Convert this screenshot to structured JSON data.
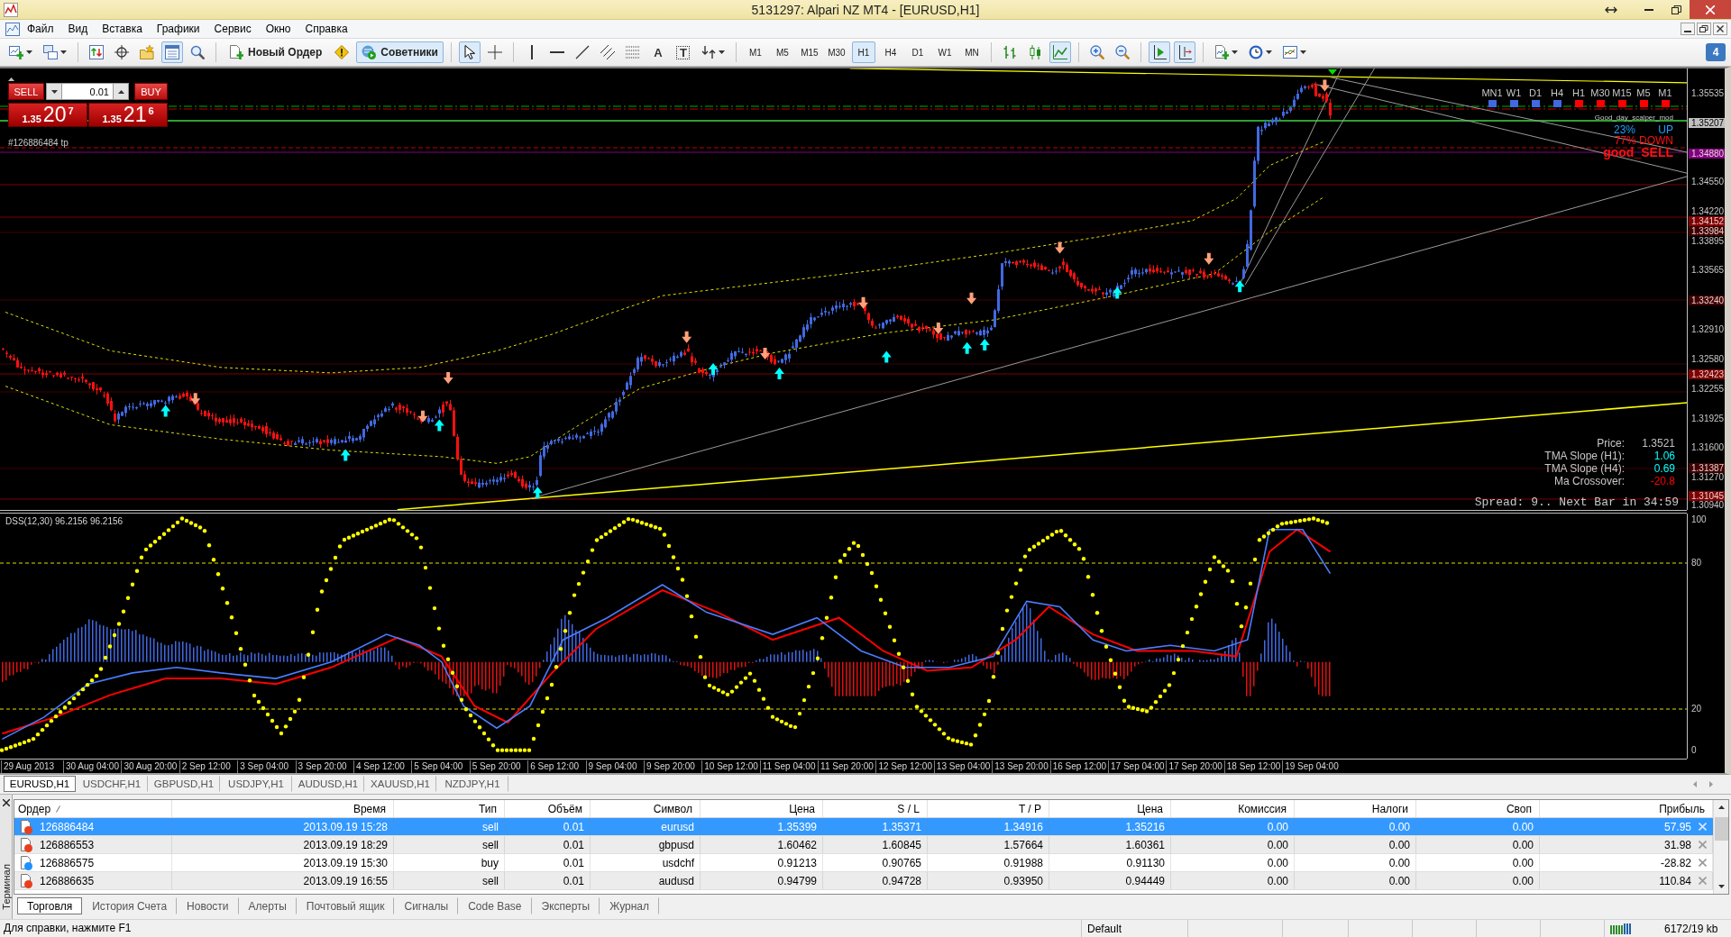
{
  "window": {
    "title": "5131297: Alpari NZ MT4 - [EURUSD,H1]"
  },
  "menu": [
    "Файл",
    "Вид",
    "Вставка",
    "Графики",
    "Сервис",
    "Окно",
    "Справка"
  ],
  "toolbar": {
    "window_tools": [
      {
        "kind": "new-chart",
        "pressed": false
      },
      {
        "kind": "profiles",
        "pressed": false
      },
      {
        "kind": "market-watch",
        "pressed": false
      },
      {
        "kind": "data-window",
        "pressed": false
      },
      {
        "kind": "favorites",
        "pressed": false
      },
      {
        "kind": "terminal",
        "pressed": true
      },
      {
        "kind": "tester",
        "pressed": false
      }
    ],
    "new_order": "Новый Ордер",
    "experts": {
      "label": "Советники",
      "pressed": true
    },
    "line_tools": [
      {
        "kind": "cursor",
        "selected": true
      },
      {
        "kind": "crosshair",
        "selected": false
      },
      {
        "kind": "vertical-line",
        "selected": false
      },
      {
        "kind": "horizontal-line",
        "selected": false
      },
      {
        "kind": "trend-line",
        "selected": false
      },
      {
        "kind": "channel",
        "selected": false
      },
      {
        "kind": "grid",
        "selected": false
      },
      {
        "kind": "text",
        "label": "A",
        "selected": false
      },
      {
        "kind": "text-label",
        "label": "T",
        "selected": false
      },
      {
        "kind": "arrows",
        "selected": false
      }
    ],
    "timeframes": [
      {
        "label": "M1",
        "selected": false
      },
      {
        "label": "M5",
        "selected": false
      },
      {
        "label": "M15",
        "selected": false
      },
      {
        "label": "M30",
        "selected": false
      },
      {
        "label": "H1",
        "selected": true
      },
      {
        "label": "H4",
        "selected": false
      },
      {
        "label": "D1",
        "selected": false
      },
      {
        "label": "W1",
        "selected": false
      },
      {
        "label": "MN",
        "selected": false
      }
    ],
    "chart_types": [
      {
        "kind": "bars",
        "selected": false
      },
      {
        "kind": "candles",
        "selected": false
      },
      {
        "kind": "line",
        "selected": true
      }
    ],
    "view_toggles": [
      {
        "kind": "autoscroll",
        "pressed": true
      },
      {
        "kind": "shift",
        "pressed": true
      }
    ],
    "messages_badge": "4"
  },
  "chart": {
    "trade_panel": {
      "sell_label": "SELL",
      "buy_label": "BUY",
      "lot": "0.01",
      "sell_price": {
        "prefix": "1.35",
        "big": "20",
        "sup": "7"
      },
      "buy_price": {
        "prefix": "1.35",
        "big": "21",
        "sup": "6"
      }
    },
    "order_line_label": "#126886484 tp",
    "timeframe_signals": [
      {
        "label": "MN1",
        "color": "#4169e1"
      },
      {
        "label": "W1",
        "color": "#4169e1"
      },
      {
        "label": "D1",
        "color": "#4169e1"
      },
      {
        "label": "H4",
        "color": "#4169e1"
      },
      {
        "label": "H1",
        "color": "#ff0000"
      },
      {
        "label": "M30",
        "color": "#ff0000"
      },
      {
        "label": "M15",
        "color": "#ff0000"
      },
      {
        "label": "M5",
        "color": "#ff0000"
      },
      {
        "label": "M1",
        "color": "#ff0000"
      }
    ],
    "indicator_name": "Good_day_scalper_mod",
    "trend_odds": {
      "up_share": "23%",
      "up_label": "UP",
      "down": "77% DOWN",
      "signal": "good_SELL"
    },
    "info": [
      {
        "label": "Price:",
        "value": "1.3521",
        "color": "#c0c0c0"
      },
      {
        "label": "TMA Slope (H1):",
        "value": "1.06",
        "color": "#00ffff"
      },
      {
        "label": "TMA Slope (H4):",
        "value": "0.69",
        "color": "#00ffff"
      },
      {
        "label": "Ma Crossover:",
        "value": "-20.8",
        "color": "#ff0000"
      }
    ],
    "spread": "Spread: 9.. Next Bar in 34:59",
    "price_axis": {
      "ticks": [
        "1.35535",
        "1.34550",
        "1.34220",
        "1.33895",
        "1.33565",
        "1.32910",
        "1.32580",
        "1.32255",
        "1.31925",
        "1.31600",
        "1.31270",
        "1.30940"
      ],
      "levels": [
        {
          "label": "1.35207",
          "color": "#c0c0c0"
        },
        {
          "label": "1.34880",
          "color": "#800080"
        },
        {
          "label": "1.34152",
          "color": "#800000"
        },
        {
          "label": "1.33984",
          "color": "#400000"
        },
        {
          "label": "1.33240",
          "color": "#400000"
        },
        {
          "label": "1.32423",
          "color": "#800000"
        },
        {
          "label": "1.31387",
          "color": "#400000"
        },
        {
          "label": "1.31045",
          "color": "#800000"
        }
      ]
    },
    "oscillator": {
      "label": "DSS(12,30) 96.2156 96.2156",
      "ticks": [
        "100",
        "80",
        "20",
        "0"
      ]
    },
    "time_axis": [
      "29 Aug 2013",
      "30 Aug 04:00",
      "30 Aug 20:00",
      "2 Sep 12:00",
      "3 Sep 04:00",
      "3 Sep 20:00",
      "4 Sep 12:00",
      "5 Sep 04:00",
      "5 Sep 20:00",
      "6 Sep 12:00",
      "9 Sep 04:00",
      "9 Sep 20:00",
      "10 Sep 12:00",
      "11 Sep 04:00",
      "11 Sep 20:00",
      "12 Sep 12:00",
      "13 Sep 04:00",
      "13 Sep 20:00",
      "16 Sep 12:00",
      "17 Sep 04:00",
      "17 Sep 20:00",
      "18 Sep 12:00",
      "19 Sep 04:00"
    ]
  },
  "chart_tabs": [
    {
      "label": "EURUSD,H1",
      "selected": true
    },
    {
      "label": "USDCHF,H1",
      "selected": false
    },
    {
      "label": "GBPUSD,H1",
      "selected": false
    },
    {
      "label": "USDJPY,H1",
      "selected": false
    },
    {
      "label": "AUDUSD,H1",
      "selected": false
    },
    {
      "label": "XAUUSD,H1",
      "selected": false
    },
    {
      "label": "NZDJPY,H1",
      "selected": false
    }
  ],
  "terminal": {
    "title": "Терминал",
    "columns": [
      "Ордер",
      "Время",
      "Тип",
      "Объём",
      "Символ",
      "Цена",
      "S / L",
      "T / P",
      "Цена",
      "Комиссия",
      "Налоги",
      "Своп",
      "Прибыль"
    ],
    "rows": [
      {
        "selected": true,
        "color": "#e8401c",
        "cells": [
          "126886484",
          "2013.09.19 15:28",
          "sell",
          "0.01",
          "eurusd",
          "1.35399",
          "1.35371",
          "1.34916",
          "1.35216",
          "0.00",
          "0.00",
          "0.00",
          "57.95"
        ]
      },
      {
        "selected": false,
        "color": "#e8401c",
        "cells": [
          "126886553",
          "2013.09.19 18:29",
          "sell",
          "0.01",
          "gbpusd",
          "1.60462",
          "1.60845",
          "1.57664",
          "1.60361",
          "0.00",
          "0.00",
          "0.00",
          "31.98"
        ]
      },
      {
        "selected": false,
        "color": "#1e90ff",
        "cells": [
          "126886575",
          "2013.09.19 15:30",
          "buy",
          "0.01",
          "usdchf",
          "0.91213",
          "0.90765",
          "0.91988",
          "0.91130",
          "0.00",
          "0.00",
          "0.00",
          "-28.82"
        ]
      },
      {
        "selected": false,
        "color": "#e8401c",
        "cells": [
          "126886635",
          "2013.09.19 16:55",
          "sell",
          "0.01",
          "audusd",
          "0.94799",
          "0.94728",
          "0.93950",
          "0.94449",
          "0.00",
          "0.00",
          "0.00",
          "110.84"
        ]
      }
    ],
    "tabs": [
      {
        "label": "Торговля",
        "selected": true
      },
      {
        "label": "История Счета",
        "selected": false
      },
      {
        "label": "Новости",
        "selected": false
      },
      {
        "label": "Алерты",
        "selected": false
      },
      {
        "label": "Почтовый ящик",
        "selected": false
      },
      {
        "label": "Сигналы",
        "selected": false
      },
      {
        "label": "Code Base",
        "selected": false
      },
      {
        "label": "Эксперты",
        "selected": false
      },
      {
        "label": "Журнал",
        "selected": false
      }
    ]
  },
  "status_bar": {
    "help": "Для справки, нажмите F1",
    "profile": "Default",
    "traffic": "6172/19 kb"
  }
}
